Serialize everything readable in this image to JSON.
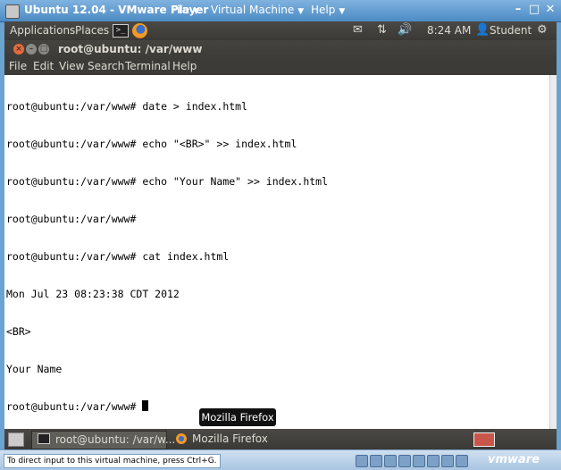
{
  "vm": {
    "title": "Ubuntu 12.04 - VMware Player",
    "menus": [
      "File",
      "Virtual Machine",
      "Help"
    ],
    "status_message": "To direct input to this virtual machine, press Ctrl+G.",
    "logo_text": "vmware"
  },
  "ubuntu_panel": {
    "applications": "Applications",
    "places": "Places",
    "time": "8:24 AM",
    "user": "Student",
    "icons": [
      "mail-icon",
      "network-icon",
      "volume-icon",
      "user-icon",
      "gear-icon"
    ]
  },
  "terminal": {
    "title": "root@ubuntu: /var/www",
    "menu": [
      "File",
      "Edit",
      "View",
      "Search",
      "Terminal",
      "Help"
    ],
    "lines": [
      "root@ubuntu:/var/www# date > index.html",
      "root@ubuntu:/var/www# echo \"<BR>\" >> index.html",
      "root@ubuntu:/var/www# echo \"Your Name\" >> index.html",
      "root@ubuntu:/var/www#",
      "root@ubuntu:/var/www# cat index.html",
      "Mon Jul 23 08:23:38 CDT 2012",
      "<BR>",
      "Your Name"
    ],
    "prompt": "root@ubuntu:/var/www# "
  },
  "tooltip": "Mozilla Firefox",
  "taskbar": {
    "items": [
      {
        "label": "root@ubuntu: /var/w..."
      },
      {
        "label": "Mozilla Firefox"
      }
    ]
  },
  "colors": {
    "vm_accent": "#4d8bc4",
    "ubuntu_panel": "#3c3b37",
    "close_button": "#e66a3a"
  }
}
